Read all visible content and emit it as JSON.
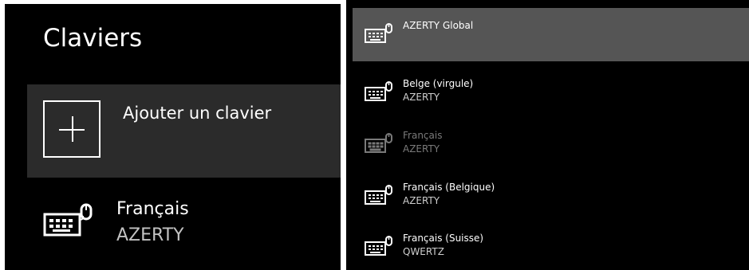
{
  "left": {
    "title": "Claviers",
    "add_label": "Ajouter un clavier",
    "current": {
      "name": "Français",
      "layout": "AZERTY",
      "icon": "keyboard-icon"
    }
  },
  "right": {
    "items": [
      {
        "name": "AZERTY Global",
        "layout": "",
        "state": "selected",
        "icon": "keyboard-icon"
      },
      {
        "name": "Belge (virgule)",
        "layout": "AZERTY",
        "state": "normal",
        "icon": "keyboard-icon"
      },
      {
        "name": "Français",
        "layout": "AZERTY",
        "state": "disabled",
        "icon": "keyboard-icon"
      },
      {
        "name": "Français (Belgique)",
        "layout": "AZERTY",
        "state": "normal",
        "icon": "keyboard-icon"
      },
      {
        "name": "Français (Suisse)",
        "layout": "QWERTZ",
        "state": "normal",
        "icon": "keyboard-icon"
      }
    ]
  },
  "colors": {
    "background": "#000000",
    "selected": "#555555",
    "add_row": "#2b2b2b",
    "disabled_text": "#7a7a7a"
  }
}
